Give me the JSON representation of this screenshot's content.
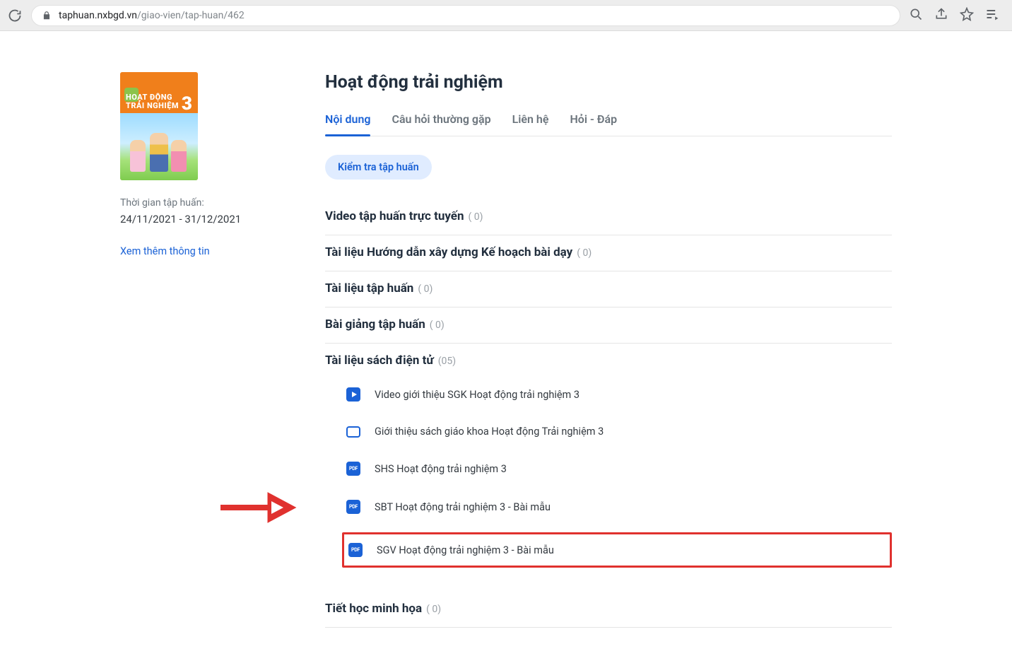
{
  "browser": {
    "url_host": "taphuan.nxbgd.vn",
    "url_path": "/giao-vien/tap-huan/462"
  },
  "sidebar": {
    "cover_line1": "HOẠT ĐỘNG",
    "cover_line2": "TRẢI NGHIỆM",
    "cover_grade": "3",
    "period_label": "Thời gian tập huấn:",
    "period_value": "24/11/2021 - 31/12/2021",
    "more_link": "Xem thêm thông tin"
  },
  "main": {
    "title": "Hoạt động trải nghiệm",
    "tabs": {
      "content": "Nội dung",
      "faq": "Câu hỏi thường gặp",
      "contact": "Liên hệ",
      "qa": "Hỏi - Đáp"
    },
    "quiz_button": "Kiểm tra tập huấn",
    "sections": {
      "video_online": {
        "title": "Video tập huấn trực tuyến",
        "count": "( 0)"
      },
      "guide": {
        "title": "Tài liệu Hướng dẫn xây dựng Kế hoạch bài dạy",
        "count": "( 0)"
      },
      "materials": {
        "title": "Tài liệu tập huấn",
        "count": "( 0)"
      },
      "lectures": {
        "title": "Bài giảng tập huấn",
        "count": "( 0)"
      },
      "ebooks": {
        "title": "Tài liệu sách điện tử",
        "count": "(05)"
      },
      "demo": {
        "title": "Tiết học minh họa",
        "count": "( 0)"
      }
    },
    "ebook_items": {
      "i0": "Video giới thiệu SGK Hoạt động trải nghiệm 3",
      "i1": "Giới thiệu sách giáo khoa Hoạt động Trải nghiệm 3",
      "i2": "SHS Hoạt động trải nghiệm 3",
      "i3": "SBT Hoạt động trải nghiệm 3 - Bài mẫu",
      "i4": "SGV Hoạt động trải nghiệm 3 - Bài mẫu"
    },
    "pdf_label": "PDF"
  }
}
